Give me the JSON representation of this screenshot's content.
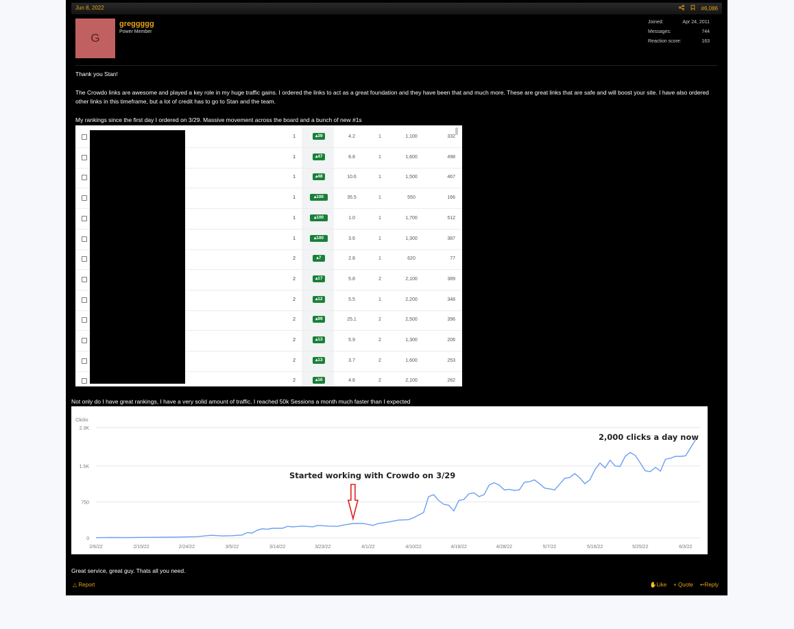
{
  "post": {
    "date": "Jun 8, 2022",
    "number": "#6,086",
    "author": {
      "avatar_letter": "G",
      "username": "greggggg",
      "title": "Power Member",
      "stats": [
        {
          "label": "Joined:",
          "value": "Apr 24, 2011"
        },
        {
          "label": "Messages:",
          "value": "744"
        },
        {
          "label": "Reaction score:",
          "value": "163"
        }
      ]
    },
    "body": {
      "p1": "Thank you Stan!",
      "p2": "The Crowdo links are awesome and played a key role in my huge traffic gains. I ordered the links to act as a great foundation and they have been that and much more. These are great links that are safe and will boost your site. I have also ordered other links in this timeframe, but a lot of credit has to go to Stan and the team.",
      "p3": "My rankings since the first day I ordered on 3/29. Massive movement across the board and a bunch of new #1s",
      "p4": "Not only do I have great rankings, I have a very solid amount of traffic. I reached 50k Sessions a month much faster than I expected",
      "p5": "Great service, great guy. Thats all you need."
    },
    "footer": {
      "report": "Report",
      "like": "Like",
      "quote": "+ Quote",
      "reply": "Reply"
    }
  },
  "rankings": [
    {
      "pos": "1",
      "change": "39",
      "c3": "4.2",
      "c4": "1",
      "c5": "1,100",
      "c6": "332"
    },
    {
      "pos": "1",
      "change": "47",
      "c3": "8.8",
      "c4": "1",
      "c5": "1,600",
      "c6": "498"
    },
    {
      "pos": "1",
      "change": "48",
      "c3": "10.6",
      "c4": "1",
      "c5": "1,500",
      "c6": "467"
    },
    {
      "pos": "1",
      "change": "100",
      "c3": "35.5",
      "c4": "1",
      "c5": "550",
      "c6": "166"
    },
    {
      "pos": "1",
      "change": "100",
      "c3": "1.0",
      "c4": "1",
      "c5": "1,700",
      "c6": "512"
    },
    {
      "pos": "1",
      "change": "100",
      "c3": "3.6",
      "c4": "1",
      "c5": "1,300",
      "c6": "387"
    },
    {
      "pos": "2",
      "change": "7",
      "c3": "2.8",
      "c4": "1",
      "c5": "620",
      "c6": "77"
    },
    {
      "pos": "2",
      "change": "17",
      "c3": "5.8",
      "c4": "2",
      "c5": "2,100",
      "c6": "389"
    },
    {
      "pos": "2",
      "change": "12",
      "c3": "5.5",
      "c4": "1",
      "c5": "2,200",
      "c6": "348"
    },
    {
      "pos": "2",
      "change": "99",
      "c3": "25.1",
      "c4": "2",
      "c5": "2,500",
      "c6": "396"
    },
    {
      "pos": "2",
      "change": "13",
      "c3": "5.9",
      "c4": "2",
      "c5": "1,300",
      "c6": "206"
    },
    {
      "pos": "2",
      "change": "13",
      "c3": "3.7",
      "c4": "2",
      "c5": "1,600",
      "c6": "253"
    },
    {
      "pos": "2",
      "change": "16",
      "c3": "4.6",
      "c4": "2",
      "c5": "2,100",
      "c6": "262"
    }
  ],
  "colors": {
    "accent": "#e8a317",
    "badge_green": "#188038",
    "line_blue": "#6a9ef2",
    "arrow_red": "#e02020"
  },
  "chart_data": {
    "type": "line",
    "ylabel": "Clicks",
    "yticks": [
      "0",
      "750",
      "1.5K",
      "2.3K"
    ],
    "ylim": [
      0,
      2300
    ],
    "xlabels": [
      "2/6/22",
      "2/15/22",
      "2/24/22",
      "3/5/22",
      "3/14/22",
      "3/23/22",
      "4/1/22",
      "4/10/22",
      "4/19/22",
      "4/28/22",
      "5/7/22",
      "5/16/22",
      "5/25/22",
      "6/3/22"
    ],
    "x_start": "2022-02-06",
    "x_end": "2022-06-06",
    "grid": true,
    "annotations": {
      "start_text": "Started working with Crowdo on 3/29",
      "end_text": "2,000 clicks a day now"
    },
    "series": [
      {
        "values": [
          [
            "2022-02-06",
            5
          ],
          [
            "2022-02-09",
            8
          ],
          [
            "2022-02-12",
            6
          ],
          [
            "2022-02-15",
            10
          ],
          [
            "2022-02-18",
            12
          ],
          [
            "2022-02-21",
            14
          ],
          [
            "2022-02-24",
            20
          ],
          [
            "2022-02-26",
            25
          ],
          [
            "2022-02-28",
            45
          ],
          [
            "2022-03-01",
            55
          ],
          [
            "2022-03-03",
            40
          ],
          [
            "2022-03-05",
            45
          ],
          [
            "2022-03-07",
            60
          ],
          [
            "2022-03-08",
            110
          ],
          [
            "2022-03-09",
            100
          ],
          [
            "2022-03-10",
            160
          ],
          [
            "2022-03-11",
            190
          ],
          [
            "2022-03-12",
            180
          ],
          [
            "2022-03-13",
            200
          ],
          [
            "2022-03-15",
            200
          ],
          [
            "2022-03-16",
            240
          ],
          [
            "2022-03-17",
            230
          ],
          [
            "2022-03-19",
            245
          ],
          [
            "2022-03-21",
            230
          ],
          [
            "2022-03-22",
            260
          ],
          [
            "2022-03-24",
            245
          ],
          [
            "2022-03-26",
            240
          ],
          [
            "2022-03-27",
            265
          ],
          [
            "2022-03-29",
            300
          ],
          [
            "2022-03-31",
            300
          ],
          [
            "2022-04-01",
            280
          ],
          [
            "2022-04-02",
            260
          ],
          [
            "2022-04-03",
            300
          ],
          [
            "2022-04-05",
            330
          ],
          [
            "2022-04-07",
            370
          ],
          [
            "2022-04-09",
            380
          ],
          [
            "2022-04-10",
            420
          ],
          [
            "2022-04-12",
            530
          ],
          [
            "2022-04-13",
            860
          ],
          [
            "2022-04-14",
            900
          ],
          [
            "2022-04-15",
            780
          ],
          [
            "2022-04-16",
            700
          ],
          [
            "2022-04-17",
            680
          ],
          [
            "2022-04-18",
            560
          ],
          [
            "2022-04-19",
            780
          ],
          [
            "2022-04-20",
            800
          ],
          [
            "2022-04-21",
            920
          ],
          [
            "2022-04-22",
            940
          ],
          [
            "2022-04-23",
            860
          ],
          [
            "2022-04-24",
            900
          ],
          [
            "2022-04-25",
            1100
          ],
          [
            "2022-04-26",
            1150
          ],
          [
            "2022-04-27",
            1100
          ],
          [
            "2022-04-28",
            1000
          ],
          [
            "2022-04-29",
            1010
          ],
          [
            "2022-04-30",
            990
          ],
          [
            "2022-05-01",
            1000
          ],
          [
            "2022-05-02",
            1160
          ],
          [
            "2022-05-03",
            1170
          ],
          [
            "2022-05-04",
            1210
          ],
          [
            "2022-05-05",
            1130
          ],
          [
            "2022-05-06",
            1040
          ],
          [
            "2022-05-07",
            1020
          ],
          [
            "2022-05-08",
            1000
          ],
          [
            "2022-05-09",
            1120
          ],
          [
            "2022-05-10",
            1240
          ],
          [
            "2022-05-11",
            1260
          ],
          [
            "2022-05-12",
            1340
          ],
          [
            "2022-05-13",
            1250
          ],
          [
            "2022-05-14",
            1130
          ],
          [
            "2022-05-15",
            1210
          ],
          [
            "2022-05-16",
            1420
          ],
          [
            "2022-05-17",
            1560
          ],
          [
            "2022-05-18",
            1460
          ],
          [
            "2022-05-19",
            1620
          ],
          [
            "2022-05-20",
            1500
          ],
          [
            "2022-05-21",
            1490
          ],
          [
            "2022-05-22",
            1700
          ],
          [
            "2022-05-23",
            1780
          ],
          [
            "2022-05-24",
            1720
          ],
          [
            "2022-05-25",
            1560
          ],
          [
            "2022-05-26",
            1400
          ],
          [
            "2022-05-27",
            1380
          ],
          [
            "2022-05-28",
            1470
          ],
          [
            "2022-05-29",
            1390
          ],
          [
            "2022-05-30",
            1640
          ],
          [
            "2022-05-31",
            1660
          ],
          [
            "2022-06-01",
            1700
          ],
          [
            "2022-06-02",
            1700
          ],
          [
            "2022-06-03",
            1710
          ],
          [
            "2022-06-05",
            2050
          ]
        ]
      }
    ]
  }
}
